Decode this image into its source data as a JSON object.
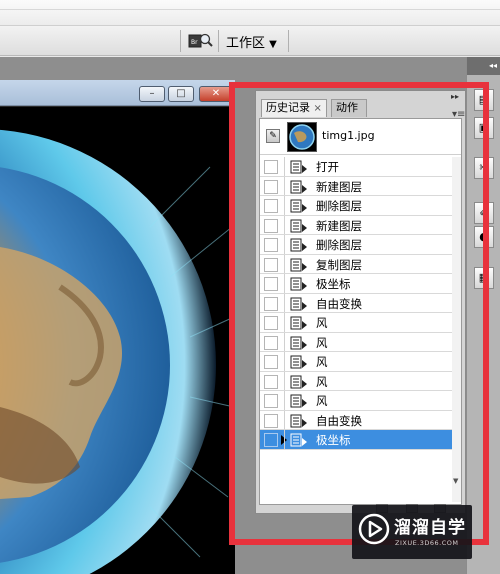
{
  "toolbar": {
    "workspace_label": "工作区",
    "workspace_arrow": "▼"
  },
  "document_window": {
    "min_label": "–",
    "max_label": "□",
    "close_label": "✕"
  },
  "history_panel": {
    "tabs": [
      {
        "label": "历史记录",
        "active": true
      },
      {
        "label": "动作",
        "active": false
      }
    ],
    "tab_close": "×",
    "snapshot": {
      "name": "timg1.jpg"
    },
    "states": [
      {
        "label": "打开"
      },
      {
        "label": "新建图层"
      },
      {
        "label": "删除图层"
      },
      {
        "label": "新建图层"
      },
      {
        "label": "删除图层"
      },
      {
        "label": "复制图层"
      },
      {
        "label": "极坐标"
      },
      {
        "label": "自由变换"
      },
      {
        "label": "风"
      },
      {
        "label": "风"
      },
      {
        "label": "风"
      },
      {
        "label": "风"
      },
      {
        "label": "风"
      },
      {
        "label": "自由变换"
      },
      {
        "label": "极坐标"
      }
    ],
    "selected_index": 14,
    "history_source_index": 14
  },
  "colors": {
    "highlight_border": "#e8323c",
    "selection": "#3d8ee0"
  },
  "watermark": {
    "title": "溜溜自学",
    "subtitle": "ZIXUE.3D66.COM"
  }
}
